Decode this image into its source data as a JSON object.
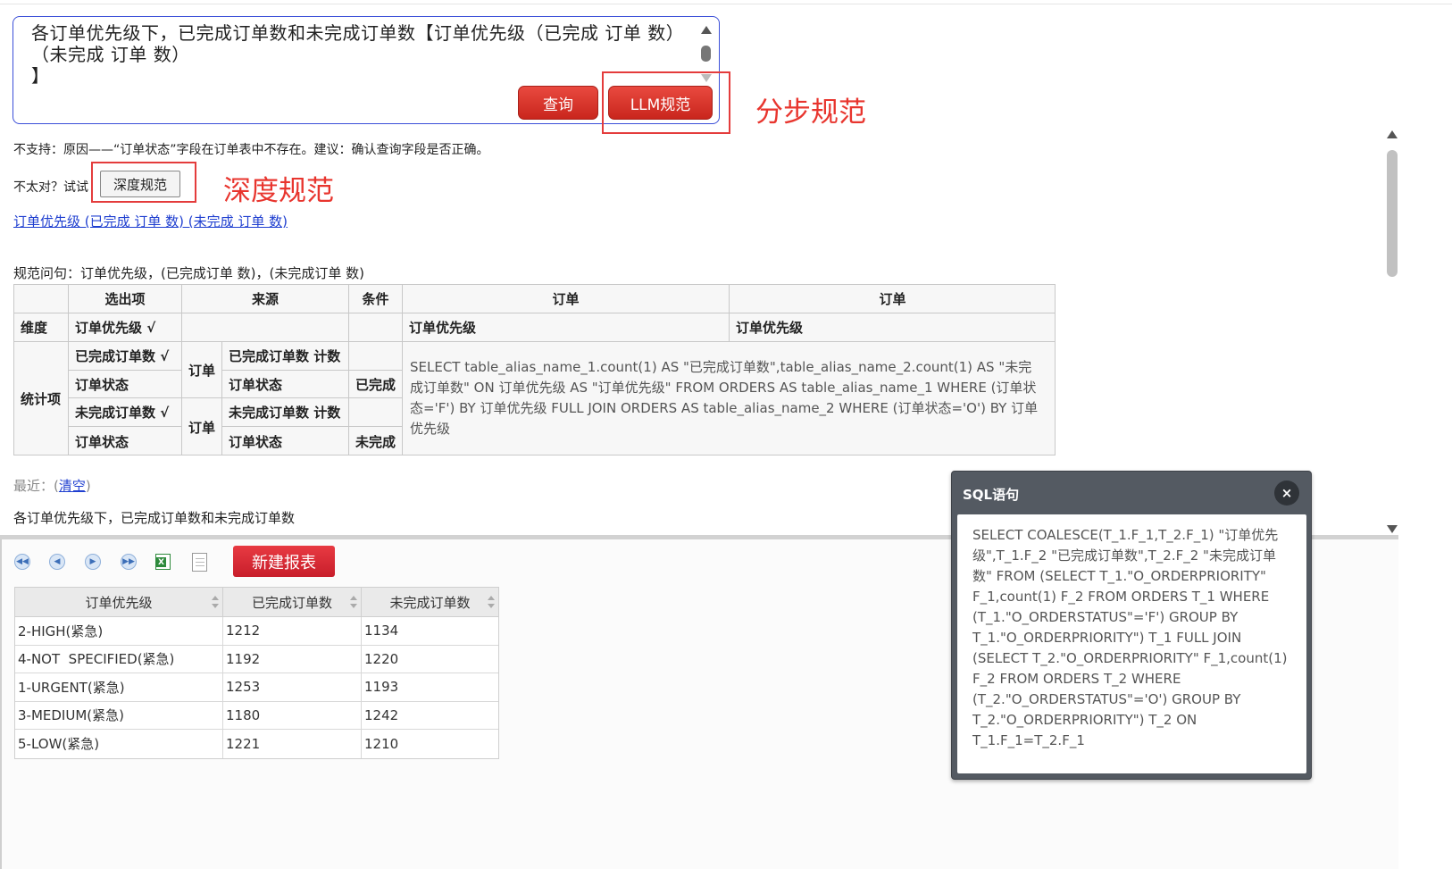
{
  "query": {
    "text": "各订单优先级下，已完成订单数和未完成订单数【订单优先级（已完成 订单 数）（未完成 订单 数）\n】",
    "query_button": "查询",
    "llm_button": "LLM规范"
  },
  "annotations": {
    "step_norm": "分步规范",
    "deep_norm": "深度规范"
  },
  "message": {
    "not_supported": "不支持：原因——“订单状态”字段在订单表中不存在。建议：确认查询字段是否正确。",
    "try_label": "不太对？试试",
    "deep_button": "深度规范",
    "link_text": "订单优先级 (已完成 订单 数) (未完成 订单 数)",
    "normalized_question": "规范问句：订单优先级，(已完成订单 数)，(未完成订单 数)"
  },
  "analysis": {
    "headers": [
      "选出项",
      "来源",
      "条件",
      "订单",
      "订单"
    ],
    "dimension_label": "维度",
    "dimension_item": "订单优先级 √",
    "dimension_col1": "订单优先级",
    "dimension_col2": "订单优先级",
    "stat_label": "统计项",
    "rows": [
      {
        "item": "已完成订单数 √",
        "source_table": "订单",
        "source": "已完成订单数 计数",
        "cond": ""
      },
      {
        "item": "订单状态",
        "source": "订单状态",
        "cond": "已完成"
      },
      {
        "item": "未完成订单数 √",
        "source_table": "订单",
        "source": "未完成订单数 计数",
        "cond": ""
      },
      {
        "item": "订单状态",
        "source": "订单状态",
        "cond": "未完成"
      }
    ],
    "sql": "SELECT table_alias_name_1.count(1) AS \"已完成订单数\",table_alias_name_2.count(1) AS \"未完成订单数\" ON 订单优先级 AS \"订单优先级\" FROM ORDERS AS table_alias_name_1 WHERE (订单状态='F') BY 订单优先级 FULL JOIN ORDERS AS table_alias_name_2 WHERE (订单状态='O') BY 订单优先级"
  },
  "recent": {
    "label": "最近：(",
    "clear": "清空",
    "close_paren": ")",
    "item": "各订单优先级下，已完成订单数和未完成订单数"
  },
  "toolbar": {
    "first_icon": "first-page-icon",
    "prev_icon": "prev-page-icon",
    "next_icon": "next-page-icon",
    "last_icon": "last-page-icon",
    "excel_icon": "excel-export-icon",
    "doc_icon": "document-icon",
    "new_report": "新建报表"
  },
  "results": {
    "columns": [
      "订单优先级",
      "已完成订单数",
      "未完成订单数"
    ],
    "rows": [
      [
        "2-HIGH(紧急)",
        "1212",
        "1134"
      ],
      [
        "4-NOT  SPECIFIED(紧急)",
        "1192",
        "1220"
      ],
      [
        "1-URGENT(紧急)",
        "1253",
        "1193"
      ],
      [
        "3-MEDIUM(紧急)",
        "1180",
        "1242"
      ],
      [
        "5-LOW(紧急)",
        "1221",
        "1210"
      ]
    ]
  },
  "sql_dialog": {
    "title": "SQL语句",
    "close": "×",
    "body": "SELECT COALESCE(T_1.F_1,T_2.F_1) \"订单优先级\",T_1.F_2 \"已完成订单数\",T_2.F_2 \"未完成订单数\" FROM (SELECT T_1.\"O_ORDERPRIORITY\" F_1,count(1) F_2 FROM ORDERS T_1 WHERE (T_1.\"O_ORDERSTATUS\"='F') GROUP BY T_1.\"O_ORDERPRIORITY\") T_1 FULL JOIN (SELECT T_2.\"O_ORDERPRIORITY\" F_1,count(1) F_2 FROM ORDERS T_2 WHERE (T_2.\"O_ORDERSTATUS\"='O') GROUP BY T_2.\"O_ORDERPRIORITY\") T_2 ON T_1.F_1=T_2.F_1"
  },
  "colors": {
    "accent_red": "#d8312a",
    "annotation_red": "#e8352e",
    "link_blue": "#1f3fd0",
    "query_border": "#3b4fd8"
  }
}
